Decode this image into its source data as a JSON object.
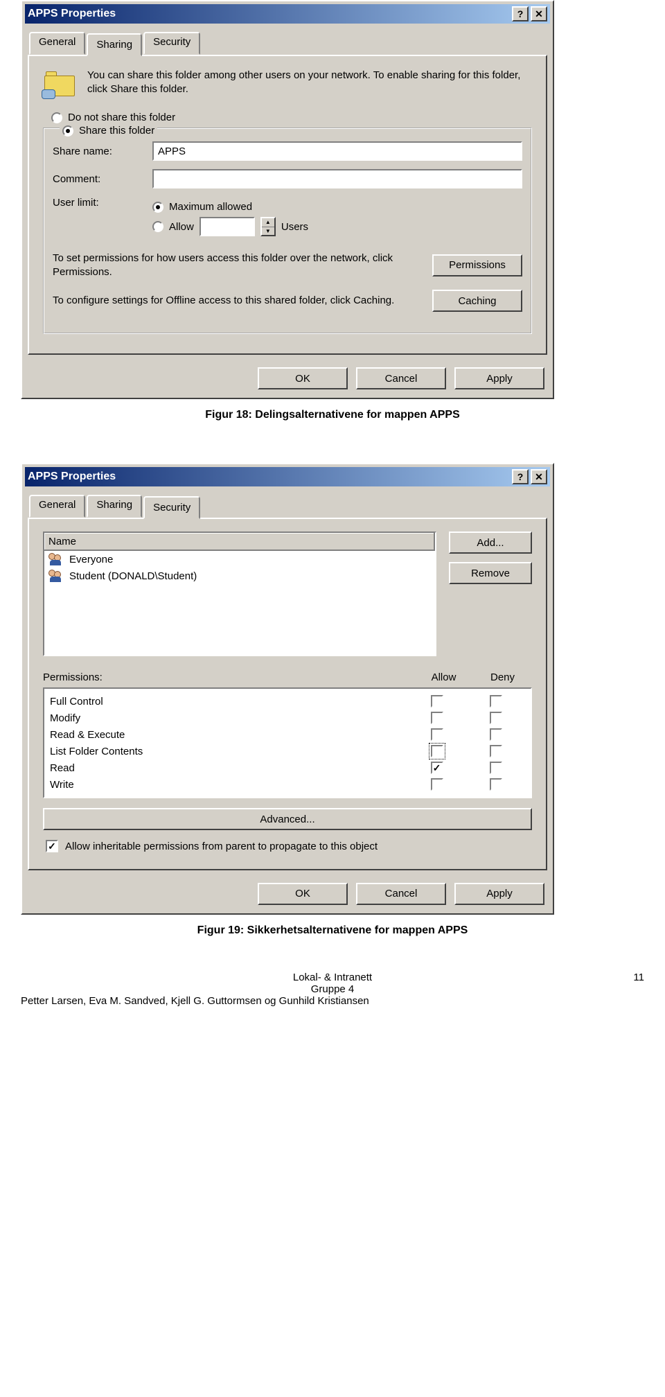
{
  "figure1": {
    "title": "APPS Properties",
    "tabs": [
      "General",
      "Sharing",
      "Security"
    ],
    "active_tab": 1,
    "intro": "You can share this folder among other users on your network.  To enable sharing for this folder, click Share this folder.",
    "radio_noshare": "Do not share this folder",
    "radio_share": "Share this folder",
    "share_name_label": "Share name:",
    "share_name_value": "APPS",
    "comment_label": "Comment:",
    "comment_value": "",
    "userlimit_label": "User limit:",
    "userlimit_max": "Maximum allowed",
    "userlimit_allow": "Allow",
    "userlimit_users": "Users",
    "perm_text": "To set permissions for how users access this folder over the network, click Permissions.",
    "perm_btn": "Permissions",
    "cache_text": "To configure settings for Offline access to this shared folder, click Caching.",
    "cache_btn": "Caching",
    "ok": "OK",
    "cancel": "Cancel",
    "apply": "Apply",
    "caption": "Figur 18: Delingsalternativene for mappen APPS"
  },
  "figure2": {
    "title": "APPS Properties",
    "tabs": [
      "General",
      "Sharing",
      "Security"
    ],
    "active_tab": 2,
    "name_header": "Name",
    "add_btn": "Add...",
    "remove_btn": "Remove",
    "users": [
      "Everyone",
      "Student (DONALD\\Student)"
    ],
    "perm_label": "Permissions:",
    "allow": "Allow",
    "deny": "Deny",
    "permissions": [
      {
        "label": "Full Control",
        "allow": false,
        "deny": false,
        "focus": false
      },
      {
        "label": "Modify",
        "allow": false,
        "deny": false,
        "focus": false
      },
      {
        "label": "Read & Execute",
        "allow": false,
        "deny": false,
        "focus": false
      },
      {
        "label": "List Folder Contents",
        "allow": false,
        "deny": false,
        "focus": true
      },
      {
        "label": "Read",
        "allow": true,
        "deny": false,
        "focus": false
      },
      {
        "label": "Write",
        "allow": false,
        "deny": false,
        "focus": false
      }
    ],
    "advanced_btn": "Advanced...",
    "inherit_checked": true,
    "inherit_text": "Allow inheritable permissions from parent to propagate to this object",
    "ok": "OK",
    "cancel": "Cancel",
    "apply": "Apply",
    "caption": "Figur 19: Sikkerhetsalternativene for mappen APPS"
  },
  "footer": {
    "center1": "Lokal- & Intranett",
    "center2": "Gruppe 4",
    "left": "Petter Larsen, Eva M. Sandved, Kjell G. Guttormsen og Gunhild Kristiansen",
    "page": "11"
  }
}
